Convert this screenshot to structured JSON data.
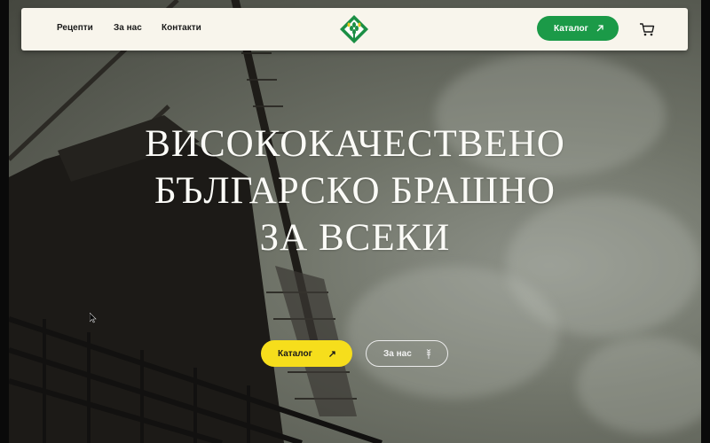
{
  "nav": {
    "links": [
      "Рецепти",
      "За нас",
      "Контакти"
    ],
    "catalog_label": "Каталог",
    "catalog_icon": "arrow-up-right-icon",
    "cart_icon": "cart-icon",
    "logo_icon": "wheat-logo-icon"
  },
  "hero": {
    "title_lines": [
      "ВИСОКОКАЧЕСТВЕНО",
      "БЪЛГАРСКО БРАШНО",
      "ЗА ВСЕКИ"
    ],
    "catalog_button": "Каталог",
    "catalog_arrow": "↗",
    "about_button": "За нас",
    "about_icon": "wheat-icon"
  },
  "colors": {
    "green": "#1b9a48",
    "yellow": "#f6de1c",
    "navbar_bg": "#f8f5ec"
  }
}
